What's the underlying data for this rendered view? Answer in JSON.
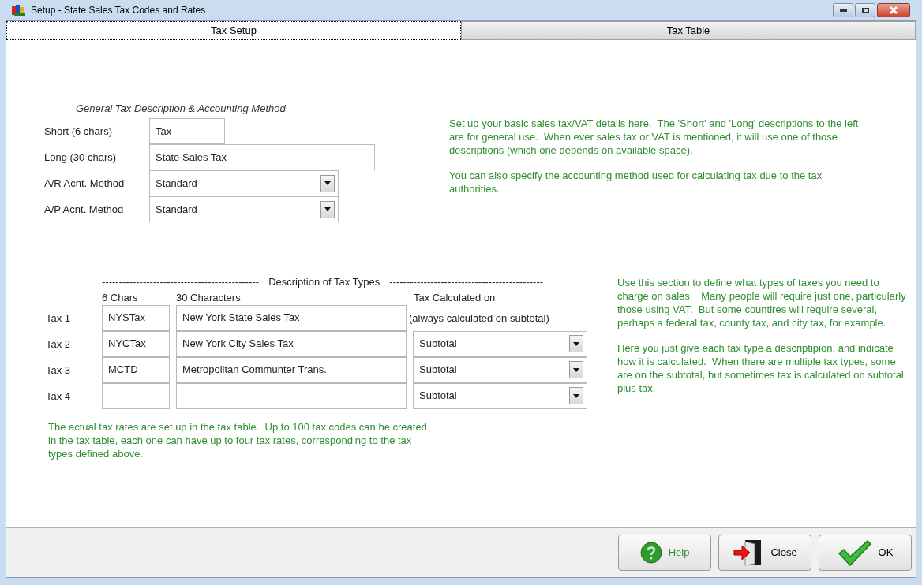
{
  "window": {
    "title": "Setup  -  State Sales Tax Codes and Rates"
  },
  "tabs": [
    {
      "label": "Tax Setup",
      "selected": true
    },
    {
      "label": "Tax Table",
      "selected": false
    }
  ],
  "general": {
    "heading": "General Tax Description & Accounting Method",
    "fields": [
      {
        "kind": "text",
        "label": "Short (6 chars)",
        "value": "Tax"
      },
      {
        "kind": "text",
        "label": "Long (30 chars)",
        "value": "State Sales Tax"
      },
      {
        "kind": "dropdown",
        "label": "A/R Acnt. Method",
        "value": "Standard"
      },
      {
        "kind": "dropdown",
        "label": "A/P Acnt. Method",
        "value": "Standard"
      }
    ]
  },
  "general_help": [
    "Set up your basic sales tax/VAT details here.  The 'Short' and 'Long' descriptions to the left are for general use.  When ever sales tax or VAT is mentioned, it will use one of those descriptions (which one depends on available space).",
    "You can also specify the accounting method used for calculating tax due to the tax authorities."
  ],
  "tax_types": {
    "dashes_left": "----------------------------------------------",
    "title": "Description of Tax Types",
    "dashes_right": "---------------------------------------------",
    "columns": [
      "6 Chars",
      "30 Characters",
      "Tax Calculated on"
    ],
    "rows": [
      {
        "label": "Tax 1",
        "short": "NYSTax",
        "long": "New York State Sales Tax",
        "kind": "note",
        "calc": "(always calculated on subtotal)"
      },
      {
        "label": "Tax 2",
        "short": "NYCTax",
        "long": "New York City Sales Tax",
        "kind": "dropdown",
        "calc": "Subtotal"
      },
      {
        "label": "Tax 3",
        "short": "MCTD",
        "long": "Metropolitan Communter Trans.",
        "kind": "dropdown",
        "calc": "Subtotal"
      },
      {
        "label": "Tax 4",
        "short": "",
        "long": "",
        "kind": "dropdown",
        "calc": "Subtotal"
      }
    ]
  },
  "tax_note": "The actual tax rates are set up in the tax table.  Up to 100 tax codes can be created in the tax table, each one can have up to four tax rates, corresponding to the tax types defined above.",
  "tax_help": [
    "Use this section to define what types of taxes you need to charge on sales.   Many people will require just one, particularly those using VAT.  But some countires will require several, perhaps a federal tax, county tax, and city tax, for example.",
    "Here you just give each tax type a descriptipion, and indicate how it is calculated.  When there are multiple tax types, some are on the subtotal, but sometimes tax is calculated on subtotal plus tax."
  ],
  "buttons": [
    {
      "kind": "help",
      "label": "Help"
    },
    {
      "kind": "close",
      "label": "Close"
    },
    {
      "kind": "ok",
      "label": "OK"
    }
  ]
}
